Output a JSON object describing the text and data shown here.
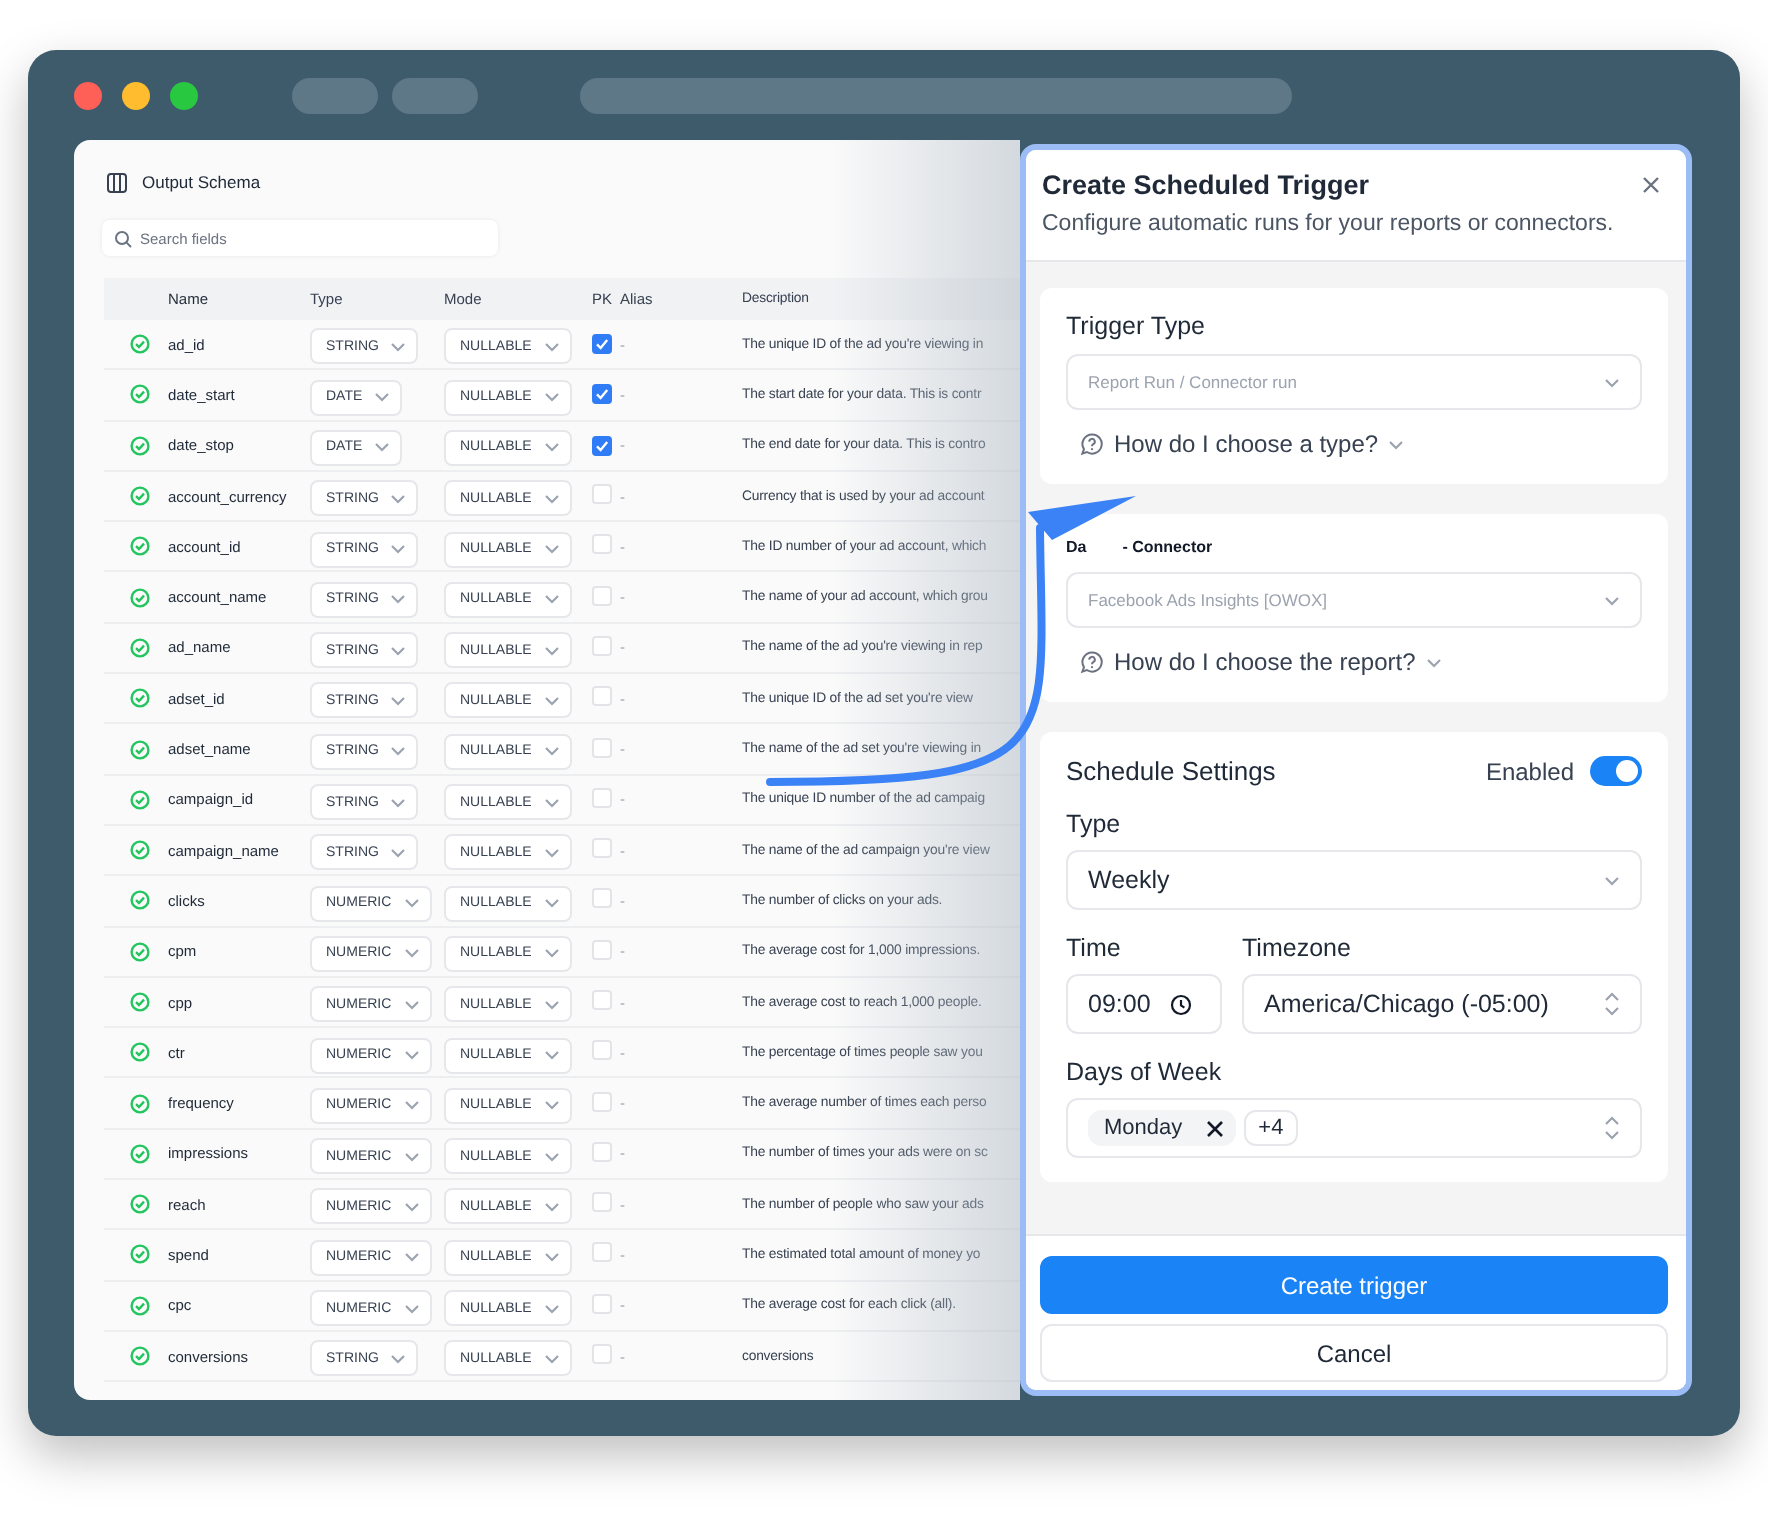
{
  "schema": {
    "title": "Output Schema",
    "search": {
      "placeholder": "Search fields"
    },
    "columns": [
      "Name",
      "Type",
      "Mode",
      "PK",
      "Alias",
      "Description"
    ],
    "rows": [
      {
        "name": "ad_id",
        "type": "STRING",
        "mode": "NULLABLE",
        "pk": true,
        "alias": "-",
        "description": "The unique ID of the ad you're viewing in"
      },
      {
        "name": "date_start",
        "type": "DATE",
        "mode": "NULLABLE",
        "pk": true,
        "alias": "-",
        "description": "The start date for your data. This is contr"
      },
      {
        "name": "date_stop",
        "type": "DATE",
        "mode": "NULLABLE",
        "pk": true,
        "alias": "-",
        "description": "The end date for your data. This is contro"
      },
      {
        "name": "account_currency",
        "type": "STRING",
        "mode": "NULLABLE",
        "pk": false,
        "alias": "-",
        "description": "Currency that is used by your ad account"
      },
      {
        "name": "account_id",
        "type": "STRING",
        "mode": "NULLABLE",
        "pk": false,
        "alias": "-",
        "description": "The ID number of your ad account, which"
      },
      {
        "name": "account_name",
        "type": "STRING",
        "mode": "NULLABLE",
        "pk": false,
        "alias": "-",
        "description": "The name of your ad account, which grou"
      },
      {
        "name": "ad_name",
        "type": "STRING",
        "mode": "NULLABLE",
        "pk": false,
        "alias": "-",
        "description": "The name of the ad you're viewing in rep"
      },
      {
        "name": "adset_id",
        "type": "STRING",
        "mode": "NULLABLE",
        "pk": false,
        "alias": "-",
        "description": "The unique ID of the ad set you're view"
      },
      {
        "name": "adset_name",
        "type": "STRING",
        "mode": "NULLABLE",
        "pk": false,
        "alias": "-",
        "description": "The name of the ad set you're viewing in"
      },
      {
        "name": "campaign_id",
        "type": "STRING",
        "mode": "NULLABLE",
        "pk": false,
        "alias": "-",
        "description": "The unique ID number of the ad campaig"
      },
      {
        "name": "campaign_name",
        "type": "STRING",
        "mode": "NULLABLE",
        "pk": false,
        "alias": "-",
        "description": "The name of the ad campaign you're view"
      },
      {
        "name": "clicks",
        "type": "NUMERIC",
        "mode": "NULLABLE",
        "pk": false,
        "alias": "-",
        "description": "The number of clicks on your ads."
      },
      {
        "name": "cpm",
        "type": "NUMERIC",
        "mode": "NULLABLE",
        "pk": false,
        "alias": "-",
        "description": "The average cost for 1,000 impressions."
      },
      {
        "name": "cpp",
        "type": "NUMERIC",
        "mode": "NULLABLE",
        "pk": false,
        "alias": "-",
        "description": "The average cost to reach 1,000 people."
      },
      {
        "name": "ctr",
        "type": "NUMERIC",
        "mode": "NULLABLE",
        "pk": false,
        "alias": "-",
        "description": "The percentage of times people saw you"
      },
      {
        "name": "frequency",
        "type": "NUMERIC",
        "mode": "NULLABLE",
        "pk": false,
        "alias": "-",
        "description": "The average number of times each perso"
      },
      {
        "name": "impressions",
        "type": "NUMERIC",
        "mode": "NULLABLE",
        "pk": false,
        "alias": "-",
        "description": "The number of times your ads were on sc"
      },
      {
        "name": "reach",
        "type": "NUMERIC",
        "mode": "NULLABLE",
        "pk": false,
        "alias": "-",
        "description": "The number of people who saw your ads"
      },
      {
        "name": "spend",
        "type": "NUMERIC",
        "mode": "NULLABLE",
        "pk": false,
        "alias": "-",
        "description": "The estimated total amount of money yo"
      },
      {
        "name": "cpc",
        "type": "NUMERIC",
        "mode": "NULLABLE",
        "pk": false,
        "alias": "-",
        "description": "The average cost for each click (all)."
      },
      {
        "name": "conversions",
        "type": "STRING",
        "mode": "NULLABLE",
        "pk": false,
        "alias": "-",
        "description": "conversions"
      }
    ]
  },
  "modal": {
    "title": "Create Scheduled Trigger",
    "subtitle": "Configure automatic runs for your reports or connectors.",
    "trigger_type": {
      "heading": "Trigger Type",
      "placeholder": "Report Run / Connector run",
      "help": "How do I choose a type?"
    },
    "connector": {
      "label_parts": [
        "Da",
        "- Connector"
      ],
      "placeholder": "Facebook Ads Insights [OWOX]",
      "help": "How do I choose the report?"
    },
    "schedule": {
      "heading": "Schedule Settings",
      "enabled_label": "Enabled",
      "enabled": true,
      "type_label": "Type",
      "type_value": "Weekly",
      "time_label": "Time",
      "time_value": "09:00",
      "timezone_label": "Timezone",
      "timezone_value": "America/Chicago (-05:00)",
      "days_label": "Days of Week",
      "days": [
        "Monday"
      ],
      "more": "+4"
    },
    "buttons": [
      {
        "label": "Create trigger",
        "kind": "primary"
      },
      {
        "label": "Cancel",
        "kind": "secondary"
      }
    ]
  }
}
